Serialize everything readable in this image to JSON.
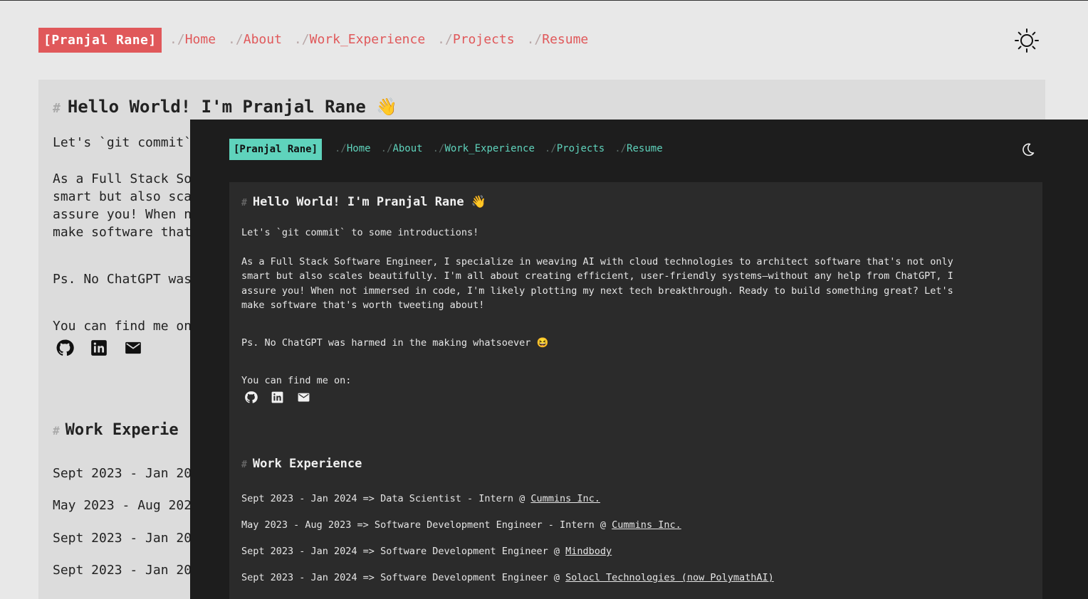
{
  "light": {
    "brand": "[Pranjal Rane]",
    "nav": [
      {
        "prefix": "./",
        "label": "Home"
      },
      {
        "prefix": "./",
        "label": "About"
      },
      {
        "prefix": "./",
        "label": "Work_Experience"
      },
      {
        "prefix": "./",
        "label": "Projects"
      },
      {
        "prefix": "./",
        "label": "Resume"
      }
    ],
    "heading_hash": "#",
    "heading": "Hello World! I'm Pranjal Rane 👋",
    "lines": [
      "Let's `git commit`",
      "As a Full Stack So",
      "smart but also sca",
      "assure you! When n",
      "make software that",
      "Ps. No ChatGPT was",
      "You can find me on:"
    ],
    "work_heading": "Work Experie",
    "jobs": [
      "Sept 2023 - Jan 20",
      "May 2023 - Aug 202",
      "Sept 2023 - Jan 20",
      "Sept 2023 - Jan 20"
    ]
  },
  "dark": {
    "brand": "[Pranjal Rane]",
    "nav": [
      {
        "prefix": "./",
        "label": "Home"
      },
      {
        "prefix": "./",
        "label": "About"
      },
      {
        "prefix": "./",
        "label": "Work_Experience"
      },
      {
        "prefix": "./",
        "label": "Projects"
      },
      {
        "prefix": "./",
        "label": "Resume"
      }
    ],
    "heading_hash": "#",
    "heading": "Hello World! I'm Pranjal Rane 👋",
    "intro": "Let's `git commit` to some introductions!",
    "para": [
      "As a Full Stack Software Engineer, I specialize in weaving AI with cloud technologies to architect software that's not only",
      "smart but also scales beautifully. I'm all about creating efficient, user-friendly systems—without any help from ChatGPT, I",
      "assure you! When not immersed in code, I'm likely plotting my next tech breakthrough. Ready to build something great? Let's",
      "make software that's worth tweeting about!"
    ],
    "ps": "Ps. No ChatGPT was harmed in the making whatsoever 😆",
    "find_me": "You can find me on:",
    "work_heading": "Work Experience",
    "jobs": [
      {
        "text": "Sept 2023 - Jan 2024 => Data Scientist - Intern @ ",
        "company": "Cummins Inc."
      },
      {
        "text": "May 2023 - Aug 2023 => Software Development Engineer - Intern @ ",
        "company": "Cummins Inc."
      },
      {
        "text": "Sept 2023 - Jan 2024 => Software Development Engineer @ ",
        "company": "Mindbody"
      },
      {
        "text": "Sept 2023 - Jan 2024 => Software Development Engineer @ ",
        "company": "Solocl Technologies (now PolymathAI)"
      }
    ]
  },
  "colors": {
    "light_accent": "#e0585a",
    "dark_accent": "#5fd3bc",
    "dark_bg": "#1d1d1d",
    "dark_card": "#2b2b2b"
  }
}
